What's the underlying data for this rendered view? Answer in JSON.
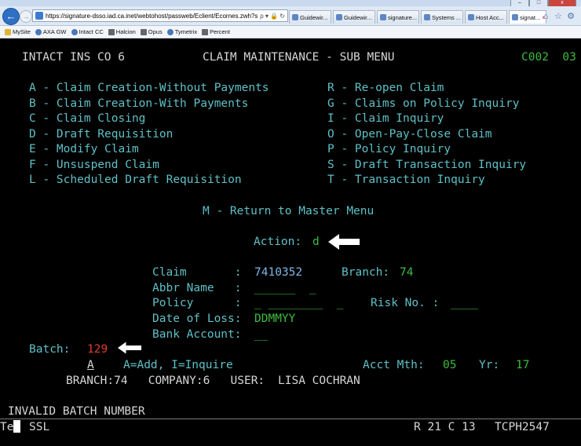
{
  "window": {
    "minimize": "–",
    "maximize": "□",
    "close": "x"
  },
  "browser": {
    "back": "←",
    "forward": "→",
    "url": "https://signature-dsso.iad.ca.inet/webtohost/passweb/Eclient/Ecornes.zwh?sessionprofil",
    "url_tools": "ρ ▾ 🔒 ↻",
    "tabs": [
      {
        "label": "Guidewir...",
        "active": false
      },
      {
        "label": "Guidewir...",
        "active": false
      },
      {
        "label": "signature...",
        "active": false
      },
      {
        "label": "Systems ...",
        "active": false
      },
      {
        "label": "Host Acc...",
        "active": false
      },
      {
        "label": "signat...",
        "active": true
      }
    ],
    "tab_close": "×",
    "right_icons": [
      "⌂",
      "☆",
      "⚙"
    ],
    "favorites": [
      "MySite",
      "AXA GW",
      "Intact CC",
      "Halcion",
      "Opus",
      "Tymetrix",
      "Percent"
    ]
  },
  "terminal": {
    "company": "INTACT INS CO 6",
    "screen_title": "CLAIM MAINTENANCE - SUB MENU",
    "screen_code": "C002  03",
    "menu_left": [
      "A - Claim Creation-Without Payments",
      "B - Claim Creation-With Payments",
      "C - Claim Closing",
      "D - Draft Requisition",
      "E - Modify Claim",
      "F - Unsuspend Claim",
      "L - Scheduled Draft Requisition"
    ],
    "menu_right": [
      "R - Re-open Claim",
      "G - Claims on Policy Inquiry",
      "I - Claim Inquiry",
      "O - Open-Pay-Close Claim",
      "P - Policy Inquiry",
      "S - Draft Transaction Inquiry",
      "T - Transaction Inquiry"
    ],
    "return_option": "M - Return to Master Menu",
    "action_label": "Action:",
    "action_value": "d",
    "claim_label": "Claim       :",
    "claim_value": "7410352",
    "branch_label": "Branch:",
    "branch_value": "74",
    "abbr_label": "Abbr Name   :",
    "abbr_value": "______  _",
    "policy_label": "Policy      :",
    "policy_value": "_ ________  _",
    "risk_label": "Risk No. :",
    "risk_value": "____",
    "dol_label": "Date of Loss:",
    "dol_value": "DDMMYY",
    "bank_label": "Bank Account:",
    "bank_value": "__",
    "batch_label": "Batch:",
    "batch_value": "129",
    "mode_value": "A",
    "mode_help": "A=Add, I=Inquire",
    "acct_mth_label": "Acct Mth:",
    "acct_mth_value": "05",
    "yr_label": "Yr:",
    "yr_value": "17",
    "branch_info": "BRANCH:74   COMPANY:6   USER:",
    "user_value": "LISA COCHRAN",
    "message": "INVALID BATCH NUMBER",
    "status_left": "Te",
    "status_ssl": "SSL",
    "status_pos": "R 21 C 13",
    "status_session": "TCPH2547"
  }
}
